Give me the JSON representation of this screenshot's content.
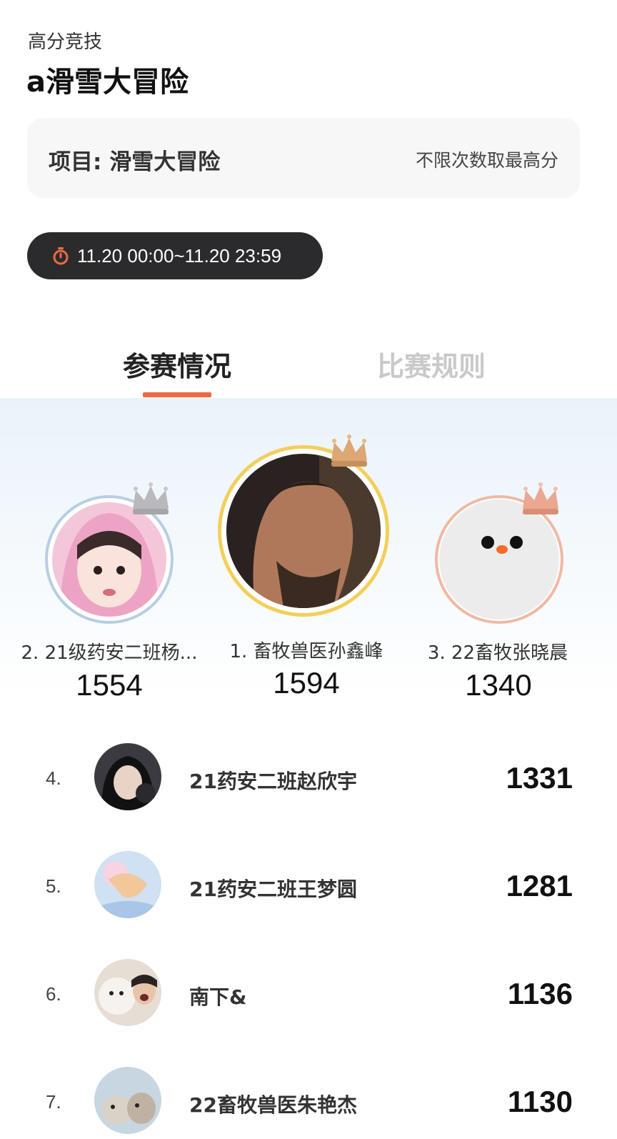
{
  "header": {
    "subtitle": "高分竞技",
    "title": "a滑雪大冒险"
  },
  "project": {
    "label": "项目: 滑雪大冒险",
    "note": "不限次数取最高分"
  },
  "time": {
    "icon": "timer-icon",
    "range": "11.20 00:00~11.20 23:59"
  },
  "tabs": [
    {
      "label": "参赛情况",
      "active": true
    },
    {
      "label": "比赛规则",
      "active": false
    }
  ],
  "podium": [
    {
      "name": "2. 21级药安二班杨...",
      "score": "1554",
      "crown": "silver-crown-icon"
    },
    {
      "name": "1. 畜牧兽医孙鑫峰",
      "score": "1594",
      "crown": "gold-crown-icon"
    },
    {
      "name": "3. 22畜牧张晓晨",
      "score": "1340",
      "crown": "bronze-crown-icon"
    }
  ],
  "ranking": [
    {
      "rank": "4.",
      "name": "21药安二班赵欣宇",
      "score": "1331"
    },
    {
      "rank": "5.",
      "name": "21药安二班王梦圆",
      "score": "1281"
    },
    {
      "rank": "6.",
      "name": "南下&",
      "score": "1136"
    },
    {
      "rank": "7.",
      "name": "22畜牧兽医朱艳杰",
      "score": "1130"
    }
  ],
  "colors": {
    "accent": "#ec6a43",
    "pill": "#2b2b2d",
    "gold": "#f3cf5a",
    "silver": "#b7cde2",
    "bronze": "#f1b8a2"
  }
}
